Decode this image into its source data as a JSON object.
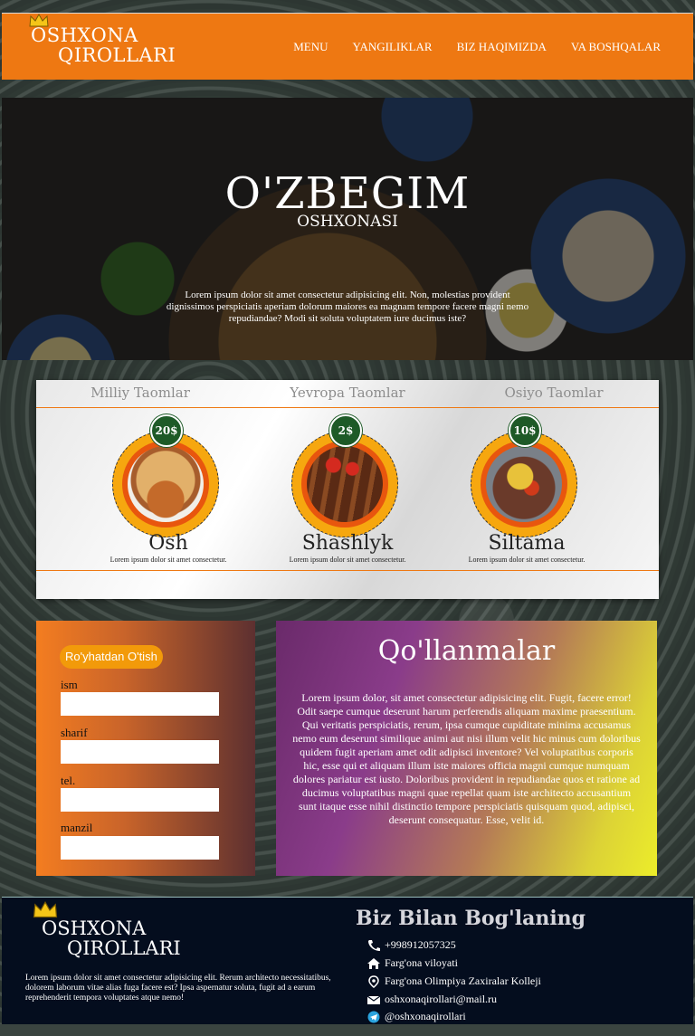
{
  "header": {
    "logo_line1": "OSHXONA",
    "logo_line2": "QIROLLARI",
    "nav": [
      "MENU",
      "YANGILIKLAR",
      "BIZ HAQIMIZDA",
      "VA BOSHQALAR"
    ]
  },
  "hero": {
    "title": "O'ZBEGIM",
    "subtitle": "OSHXONASI",
    "text": "Lorem ipsum dolor sit amet consectetur adipisicing elit. Non, molestias provident dignissimos perspiciatis aperiam dolorum maiores ea magnam tempore facere magni nemo repudiandae? Modi sit soluta voluptatem iure ducimus iste?"
  },
  "menu": {
    "categories": [
      "Milliy Taomlar",
      "Yevropa Taomlar",
      "Osiyo Taomlar"
    ],
    "dishes": [
      {
        "name": "Osh",
        "price": "20$",
        "desc": "Lorem ipsum dolor sit amet consectetur."
      },
      {
        "name": "Shashlyk",
        "price": "2$",
        "desc": "Lorem ipsum dolor sit amet consectetur."
      },
      {
        "name": "Siltama",
        "price": "10$",
        "desc": "Lorem ipsum dolor sit amet consectetur."
      }
    ]
  },
  "form": {
    "badge": "Ro'yhatdan O'tish",
    "fields": [
      "ism",
      "sharif",
      "tel.",
      "manzil"
    ]
  },
  "guide": {
    "title": "Qo'llanmalar",
    "text": "Lorem ipsum dolor, sit amet consectetur adipisicing elit. Fugit, facere error! Odit saepe cumque deserunt harum perferendis aliquam maxime praesentium. Qui veritatis perspiciatis, rerum, ipsa cumque cupiditate minima accusamus nemo eum deserunt similique animi aut nisi illum velit hic minus cum doloribus quidem fugit aperiam amet odit adipisci inventore? Vel voluptatibus corporis hic, esse qui et aliquam illum iste maiores officia magni cumque numquam dolores pariatur est iusto. Doloribus provident in repudiandae quos et ratione ad ducimus voluptatibus magni quae repellat quam iste architecto accusantium sunt itaque esse nihil distinctio tempore perspiciatis quisquam quod, adipisci, deserunt consequatur. Esse, velit id."
  },
  "footer": {
    "logo_line1": "OSHXONA",
    "logo_line2": "QIROLLARI",
    "text": "Lorem ipsum dolor sit amet consectetur adipisicing elit. Rerum architecto necessitatibus, dolorem laborum vitae alias fuga facere est? Ipsa aspernatur soluta, fugit ad a earum reprehenderit tempora voluptates atque nemo!",
    "title": "Biz Bilan Bog'laning",
    "phone": "+998912057325",
    "region": "Farg'ona viloyati",
    "address": "Farg'ona Olimpiya Zaxiralar Kolleji",
    "email": "oshxonaqirollari@mail.ru",
    "telegram": "@oshxonaqirollari"
  },
  "colors": {
    "accent": "#ee7812",
    "price_badge": "#1e5a27",
    "footer_bg": "#040d1e"
  }
}
